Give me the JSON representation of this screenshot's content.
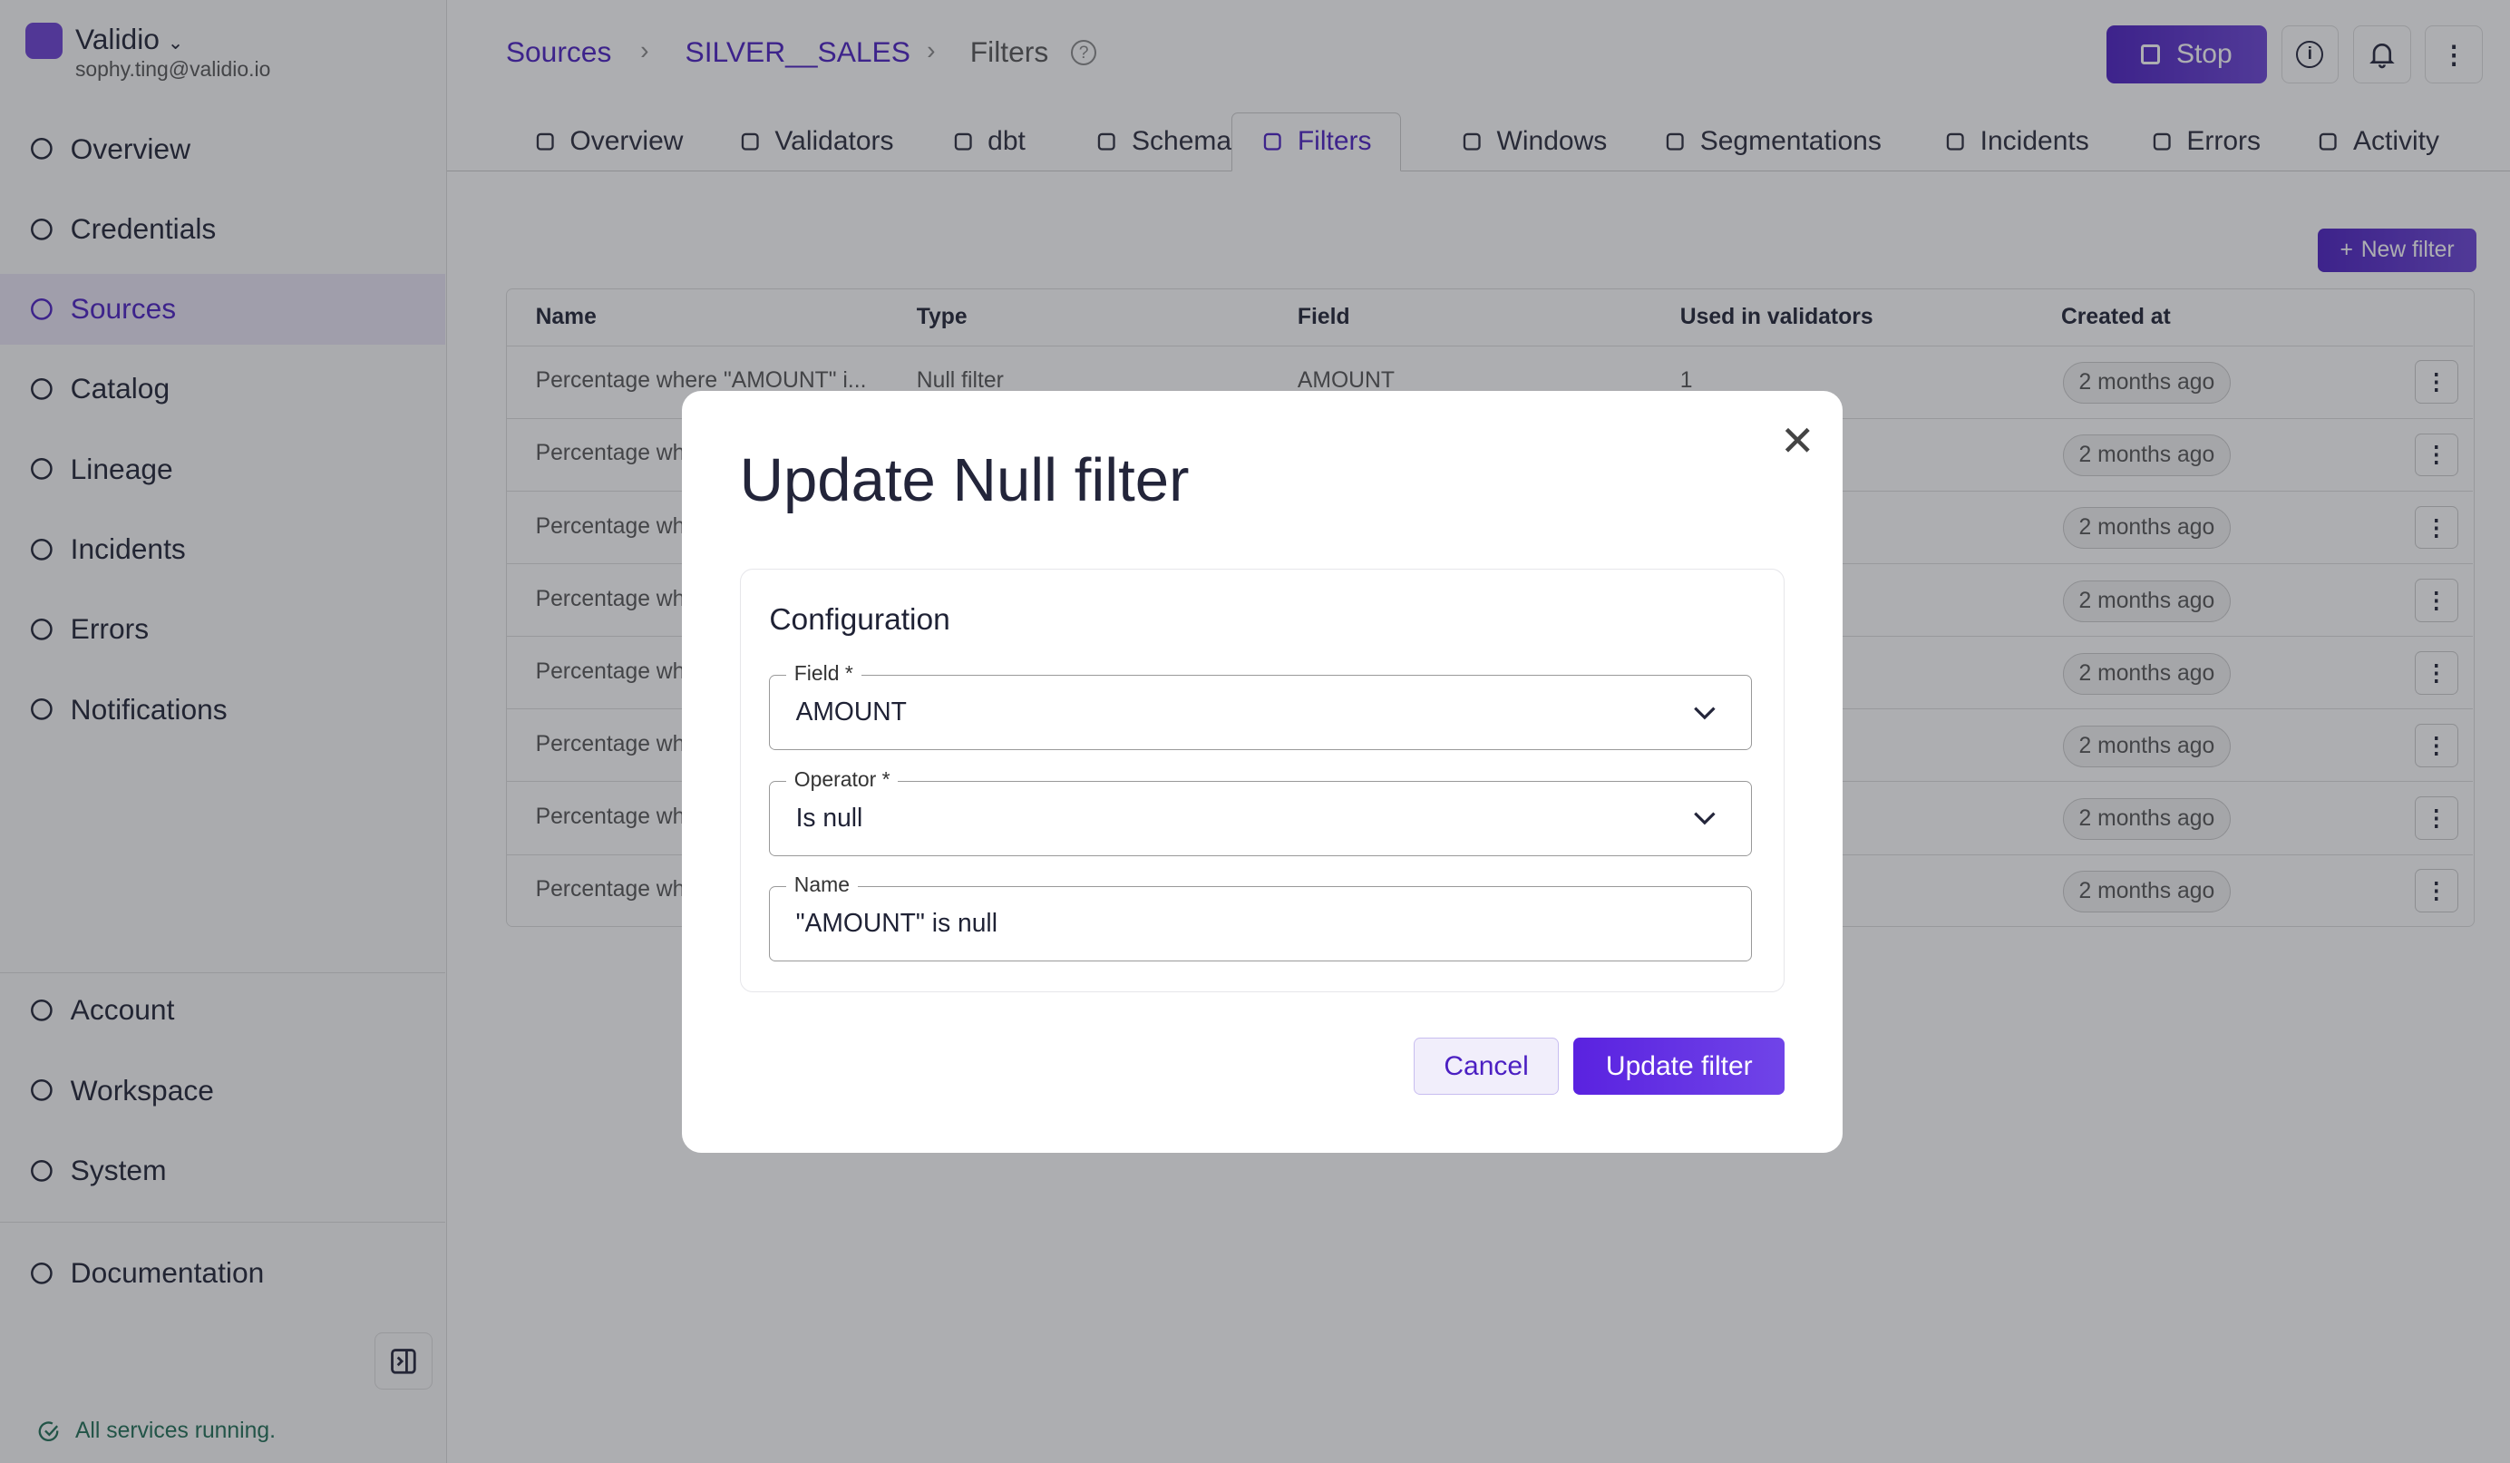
{
  "colors": {
    "accent": "#4b1fc2",
    "status": "#1f6e55"
  },
  "sidebar": {
    "org": "Validio",
    "email": "sophy.ting@validio.io",
    "items": [
      {
        "label": "Overview",
        "icon": "home-icon"
      },
      {
        "label": "Credentials",
        "icon": "key-icon"
      },
      {
        "label": "Sources",
        "icon": "sources-icon",
        "active": true
      },
      {
        "label": "Catalog",
        "icon": "catalog-icon"
      },
      {
        "label": "Lineage",
        "icon": "lineage-icon"
      },
      {
        "label": "Incidents",
        "icon": "warning-icon"
      },
      {
        "label": "Errors",
        "icon": "x-circle-icon"
      },
      {
        "label": "Notifications",
        "icon": "bell-icon"
      }
    ],
    "bottom": [
      {
        "label": "Account"
      },
      {
        "label": "Workspace"
      },
      {
        "label": "System"
      }
    ],
    "documentation": "Documentation",
    "status": "All services running."
  },
  "breadcrumb": {
    "items": [
      "Sources",
      "SILVER__SALES",
      "Filters"
    ]
  },
  "header": {
    "stop_label": "Stop"
  },
  "tabs": [
    "Overview",
    "Validators",
    "dbt",
    "Schema",
    "Filters",
    "Windows",
    "Segmentations",
    "Incidents",
    "Errors",
    "Activity"
  ],
  "active_tab": "Filters",
  "new_filter_label": "New filter",
  "table": {
    "headers": [
      "Name",
      "Type",
      "Field",
      "Used in validators",
      "Created at"
    ],
    "rows": [
      {
        "name": "Percentage where \"AMOUNT\" i...",
        "type": "Null filter",
        "field": "AMOUNT",
        "used": "1",
        "created": "2 months ago"
      },
      {
        "name": "Percentage wh",
        "created": "2 months ago"
      },
      {
        "name": "Percentage wh",
        "created": "2 months ago"
      },
      {
        "name": "Percentage wh",
        "created": "2 months ago"
      },
      {
        "name": "Percentage wh",
        "created": "2 months ago"
      },
      {
        "name": "Percentage wh",
        "created": "2 months ago"
      },
      {
        "name": "Percentage wh",
        "created": "2 months ago"
      },
      {
        "name": "Percentage wh",
        "created": "2 months ago"
      }
    ]
  },
  "modal": {
    "title": "Update Null filter",
    "section": "Configuration",
    "field": {
      "label": "Field *",
      "value": "AMOUNT"
    },
    "operator": {
      "label": "Operator *",
      "value": "Is null"
    },
    "name": {
      "label": "Name",
      "value": "\"AMOUNT\" is null"
    },
    "cancel": "Cancel",
    "submit": "Update filter"
  }
}
